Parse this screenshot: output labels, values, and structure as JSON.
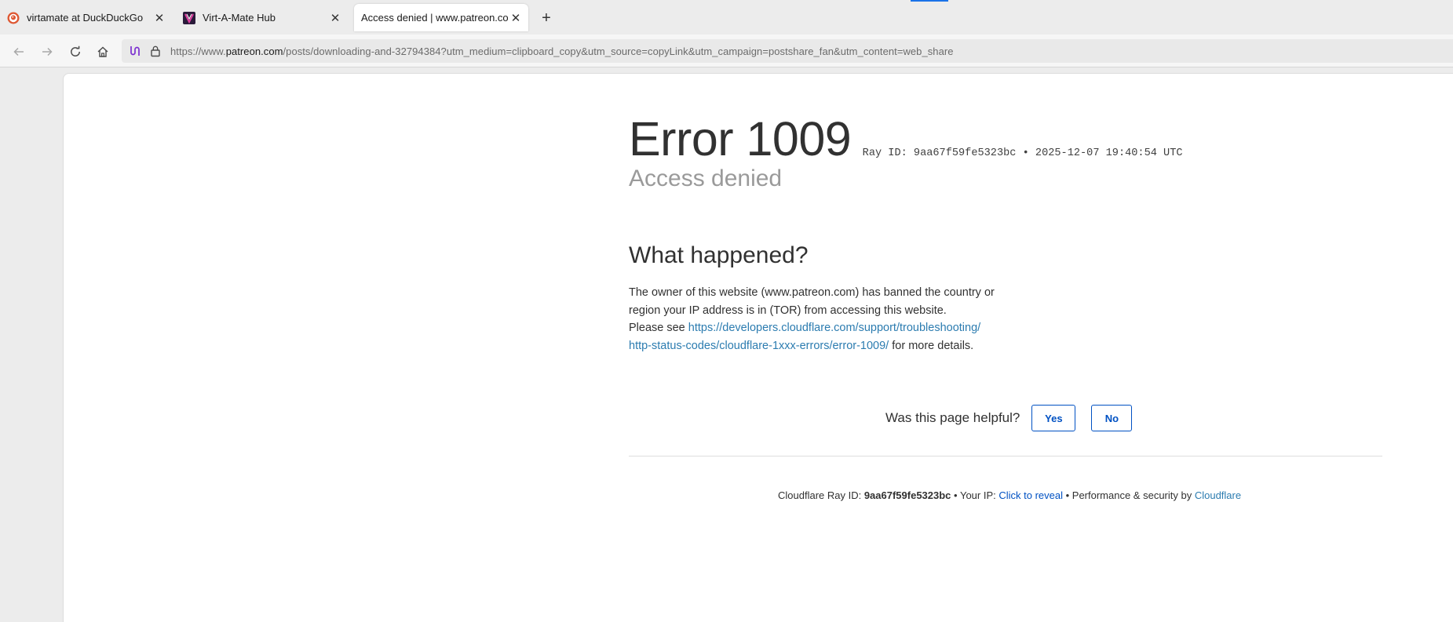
{
  "tabs": [
    {
      "title": "virtamate at DuckDuckGo",
      "icon": "duckduckgo-icon",
      "active": false
    },
    {
      "title": "Virt-A-Mate Hub",
      "icon": "vam-hub-icon",
      "active": false
    },
    {
      "title": "Access denied | www.patreon.com u",
      "icon": "none",
      "active": true
    }
  ],
  "new_tab_label": "+",
  "close_glyph": "✕",
  "address_bar": {
    "prefix": "https://www.",
    "host": "patreon.com",
    "path": "/posts/downloading-and-32794384?utm_medium=clipboard_copy&utm_source=copyLink&utm_campaign=postshare_fan&utm_content=web_share"
  },
  "error": {
    "code_title": "Error 1009",
    "ray_line": "Ray ID: 9aa67f59fe5323bc • 2025-12-07 19:40:54 UTC",
    "subtitle": "Access denied",
    "section_title": "What happened?",
    "explanation": "The owner of this website (www.patreon.com) has banned the country or region your IP address is in (TOR) from accessing this website.",
    "see_prefix": "Please see ",
    "docs_link_line1": "https://developers.cloudflare.com/support/troubleshooting/",
    "docs_link_line2": "http-status-codes/cloudflare-1xxx-errors/error-1009/",
    "see_suffix": " for more details."
  },
  "feedback": {
    "question": "Was this page helpful?",
    "yes_label": "Yes",
    "no_label": "No"
  },
  "footer": {
    "ray_label": "Cloudflare Ray ID: ",
    "ray_id": "9aa67f59fe5323bc",
    "ip_label": " • Your IP: ",
    "reveal_link": "Click to reveal",
    "perf_label": " • Performance & security by ",
    "brand_link": "Cloudflare"
  },
  "colors": {
    "accent_blue": "#0051c3",
    "link_blue": "#2c7cb0",
    "title_text": "#313131",
    "subtitle_grey": "#9a9a9a"
  }
}
